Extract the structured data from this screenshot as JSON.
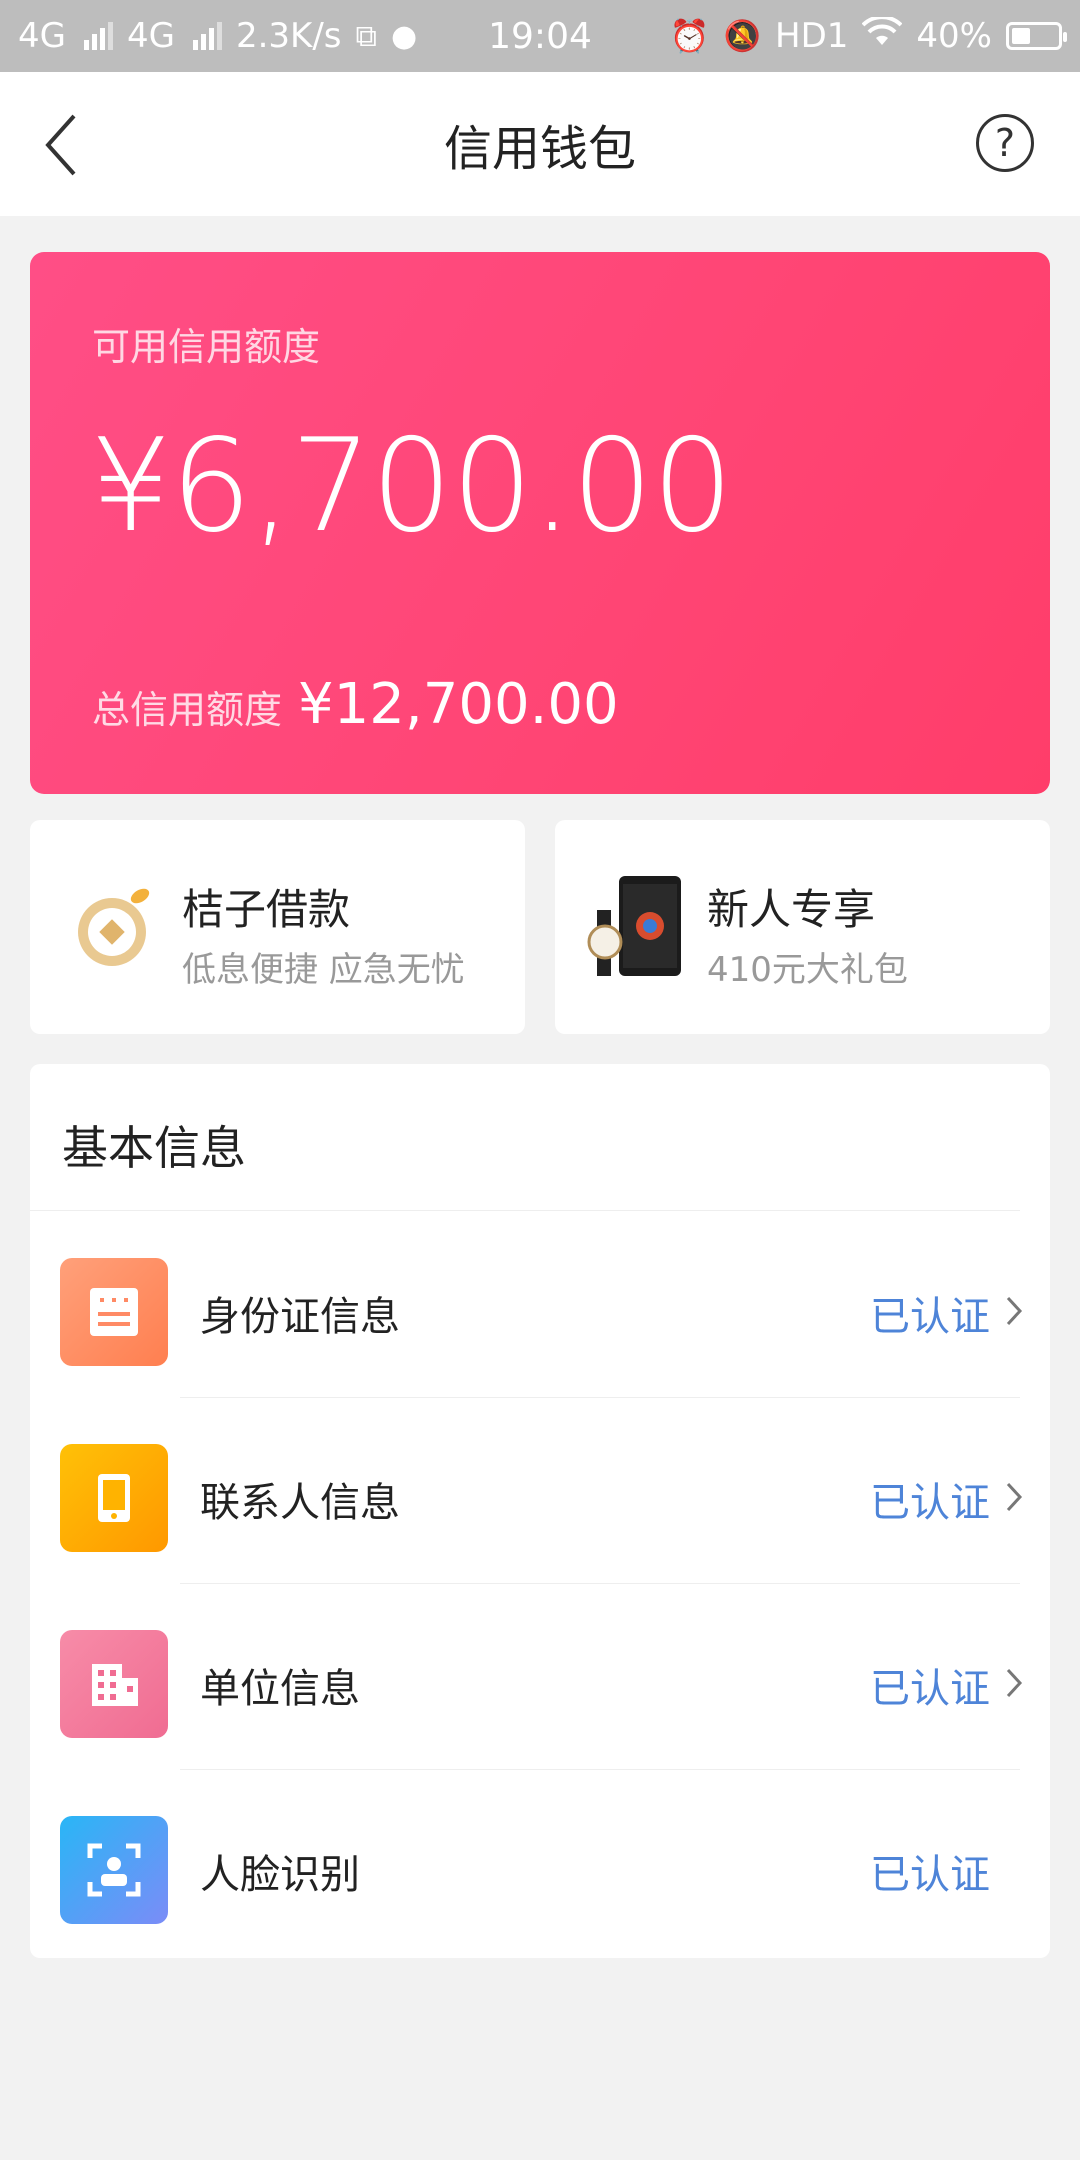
{
  "status_bar": {
    "network_1": "4G",
    "network_2": "4G",
    "speed": "2.3K/s",
    "time": "19:04",
    "hd": "HD1",
    "battery": "40%",
    "battery_level": 0.4
  },
  "nav": {
    "title": "信用钱包",
    "help_icon": "question-circle-icon",
    "back_icon": "chevron-left-icon"
  },
  "credit": {
    "available_label": "可用信用额度",
    "available_amount": "¥6,700.00",
    "total_label": "总信用额度",
    "total_amount": "¥12,700.00"
  },
  "promos": [
    {
      "title": "桔子借款",
      "subtitle": "低息便捷 应急无忧",
      "icon": "orange-coin-icon"
    },
    {
      "title": "新人专享",
      "subtitle": "410元大礼包",
      "icon": "phone-watch-gift-icon"
    }
  ],
  "basic_info": {
    "title": "基本信息",
    "rows": [
      {
        "label": "身份证信息",
        "status": "已认证",
        "icon": "id-card-icon",
        "color": "#ff8a65"
      },
      {
        "label": "联系人信息",
        "status": "已认证",
        "icon": "phone-icon",
        "color": "#ffb300"
      },
      {
        "label": "单位信息",
        "status": "已认证",
        "icon": "building-icon",
        "color": "#f06c92"
      },
      {
        "label": "人脸识别",
        "status": "已认证",
        "icon": "face-scan-icon",
        "color": "#4f8ef5"
      }
    ]
  },
  "colors": {
    "card_gradient_start": "#ff4e86",
    "card_gradient_end": "#ff3d6a",
    "status_blue": "#4e84d8"
  }
}
